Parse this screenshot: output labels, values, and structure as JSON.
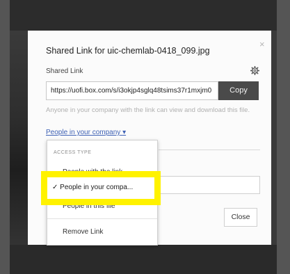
{
  "modal": {
    "title": "Shared Link for uic-chemlab-0418_099.jpg",
    "close_glyph": "×",
    "section_label": "Shared Link",
    "settings_icon": "gear-icon",
    "link_value": "https://uofi.box.com/s/i3okjp4sglq48tsims37r1mxjm0",
    "copy_label": "Copy",
    "help_text": "Anyone in your company with the link can view and download this file.",
    "access_level": "People in your company",
    "access_caret": "▾",
    "close_label": "Close"
  },
  "dropdown": {
    "header": "ACCESS TYPE",
    "items": [
      {
        "label": "People with the link",
        "selected": false
      },
      {
        "label": "People in your compa...",
        "selected": true
      },
      {
        "label": "People in this file",
        "selected": false
      }
    ],
    "remove_label": "Remove Link",
    "check_glyph": "✓"
  },
  "colors": {
    "highlight": "#fff200",
    "copy_button_bg": "#4a4a4a",
    "link_blue": "#3f62b5"
  }
}
